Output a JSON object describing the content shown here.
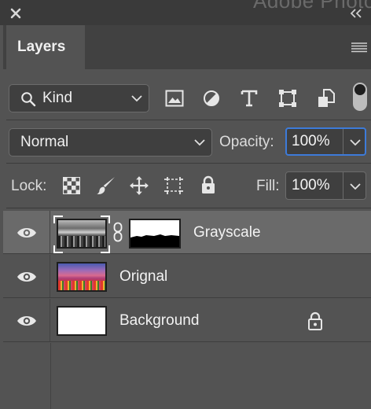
{
  "window": {
    "background_title": "Adobe Photo"
  },
  "header": {
    "tab": "Layers"
  },
  "filter": {
    "kind_label": "Kind",
    "icons": [
      "image-filter-icon",
      "adjustment-filter-icon",
      "type-filter-icon",
      "shape-filter-icon",
      "smart-object-filter-icon",
      "filter-toggle-icon"
    ]
  },
  "blend": {
    "mode": "Normal",
    "opacity_label": "Opacity:",
    "opacity_value": "100%"
  },
  "lock": {
    "label": "Lock:",
    "icons": [
      "lock-transparent-pixels-icon",
      "lock-image-pixels-icon",
      "lock-position-icon",
      "lock-artboard-icon",
      "lock-all-icon"
    ],
    "fill_label": "Fill:",
    "fill_value": "100%"
  },
  "layers": [
    {
      "name": "Grayscale",
      "selected": true,
      "has_mask": true,
      "locked": false
    },
    {
      "name": "Orignal",
      "selected": false,
      "has_mask": false,
      "locked": false
    },
    {
      "name": "Background",
      "selected": false,
      "has_mask": false,
      "locked": true
    }
  ],
  "colors": {
    "panel": "#535353",
    "selected_row": "#6a6a6a",
    "focus": "#3d7bd9"
  }
}
